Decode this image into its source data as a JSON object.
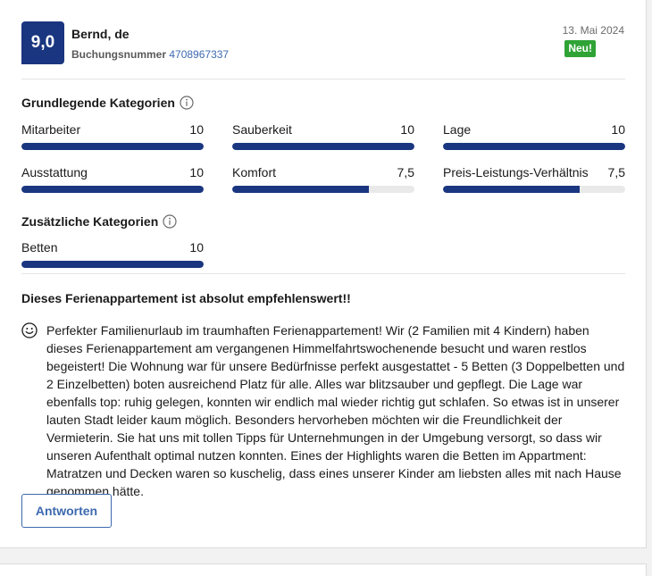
{
  "review": {
    "score": "9,0",
    "reviewer": "Bernd, de",
    "booking_label": "Buchungsnummer",
    "booking_number": "4708967337",
    "date": "13. Mai 2024",
    "badge": "Neu!",
    "colors": {
      "score_bg": "#1a3680",
      "badge_bg": "#2fa335",
      "link": "#3d69b0",
      "bar": "#1a3680"
    }
  },
  "basic": {
    "title": "Grundlegende Kategorien",
    "items": [
      {
        "label": "Mitarbeiter",
        "value": "10",
        "fraction": 1.0
      },
      {
        "label": "Sauberkeit",
        "value": "10",
        "fraction": 1.0
      },
      {
        "label": "Lage",
        "value": "10",
        "fraction": 1.0
      },
      {
        "label": "Ausstattung",
        "value": "10",
        "fraction": 1.0
      },
      {
        "label": "Komfort",
        "value": "7,5",
        "fraction": 0.75
      },
      {
        "label": "Preis-Leistungs-Verhältnis",
        "value": "7,5",
        "fraction": 0.75
      }
    ]
  },
  "extra": {
    "title": "Zusätzliche Kategorien",
    "items": [
      {
        "label": "Betten",
        "value": "10",
        "fraction": 1.0
      }
    ]
  },
  "content": {
    "headline": "Dieses Ferienappartement ist absolut empfehlenswert!!",
    "icon": "smiley-icon",
    "text": "Perfekter Familienurlaub im traumhaften Ferienappartement! Wir (2 Familien mit 4 Kindern) haben dieses Ferienappartement am vergangenen Himmelfahrtswochenende besucht und waren restlos begeistert! Die Wohnung war für unsere Bedürfnisse perfekt ausgestattet - 5 Betten (3 Doppelbetten und 2 Einzelbetten) boten ausreichend Platz für alle. Alles war blitzsauber und gepflegt. Die Lage war ebenfalls top: ruhig gelegen, konnten wir endlich mal wieder richtig gut schlafen. So etwas ist in unserer lauten Stadt leider kaum möglich. Besonders hervorheben möchten wir die Freundlichkeit der Vermieterin. Sie hat uns mit tollen Tipps für Unternehmungen in der Umgebung versorgt, so dass wir unseren Aufenthalt optimal nutzen konnten. Eines der Highlights waren die Betten im Appartment: Matratzen und Decken waren so kuschelig, dass eines unserer Kinder am liebsten alles mit nach Hause genommen hätte."
  },
  "actions": {
    "reply_label": "Antworten"
  }
}
